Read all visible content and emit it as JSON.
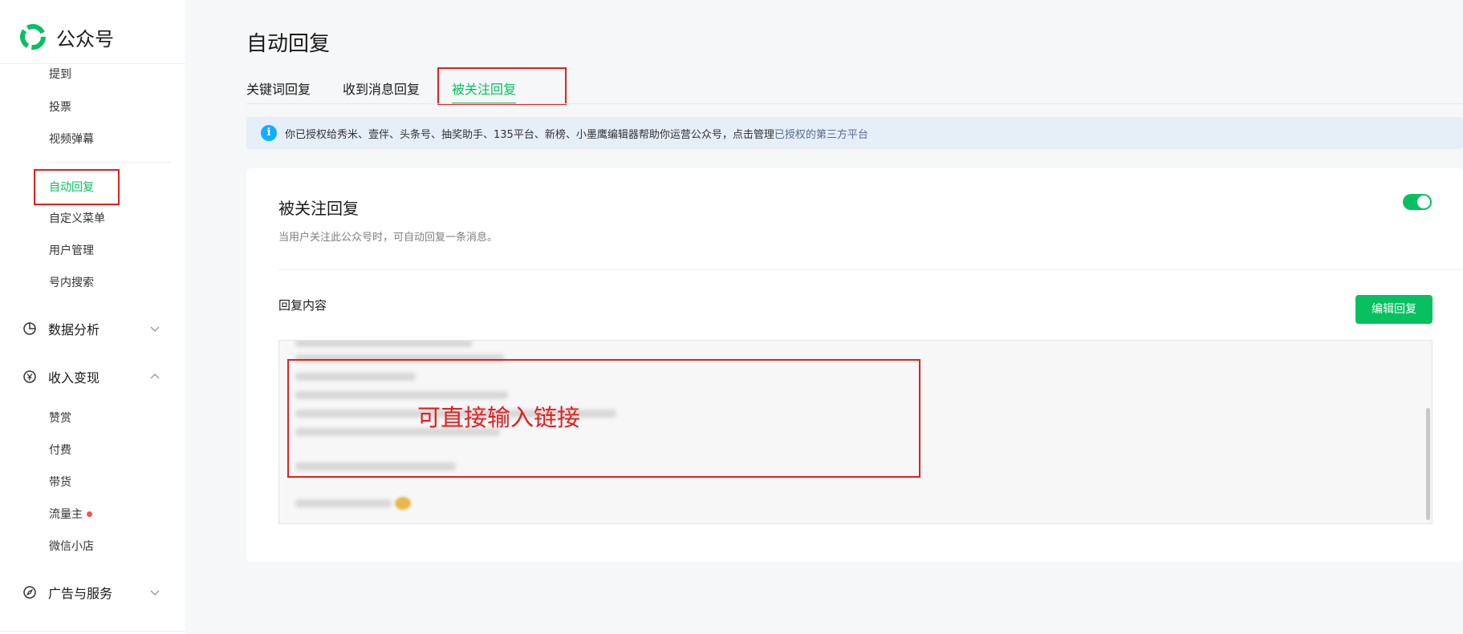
{
  "brand": {
    "name": "公众号",
    "accent": "#07c160"
  },
  "sidebar": {
    "items_top": [
      {
        "label": "提到"
      },
      {
        "label": "投票"
      },
      {
        "label": "视频弹幕"
      }
    ],
    "items_mid": [
      {
        "label": "自动回复",
        "active": true
      },
      {
        "label": "自定义菜单"
      },
      {
        "label": "用户管理"
      },
      {
        "label": "号内搜索"
      }
    ],
    "groups": [
      {
        "label": "数据分析",
        "icon": "pie-chart-icon",
        "expanded": false
      },
      {
        "label": "收入变现",
        "icon": "yen-icon",
        "expanded": true
      },
      {
        "label": "广告与服务",
        "icon": "compass-icon",
        "expanded": false
      }
    ],
    "income_items": [
      {
        "label": "赞赏"
      },
      {
        "label": "付费"
      },
      {
        "label": "带货"
      },
      {
        "label": "流量主",
        "badge": "red-dot"
      },
      {
        "label": "微信小店"
      }
    ]
  },
  "page": {
    "title": "自动回复",
    "tabs": [
      {
        "label": "关键词回复"
      },
      {
        "label": "收到消息回复"
      },
      {
        "label": "被关注回复",
        "active": true
      }
    ],
    "notice": {
      "text": "你已授权给秀米、壹伴、头条号、抽奖助手、135平台、新榜、小墨鹰编辑器帮助你运营公众号，点击管理",
      "link": "已授权的第三方平台"
    },
    "card": {
      "title": "被关注回复",
      "description": "当用户关注此公众号时，可自动回复一条消息。",
      "toggle_on": true,
      "reply_label": "回复内容",
      "edit_button": "编辑回复"
    },
    "annotation_overlay": "可直接输入链接"
  }
}
